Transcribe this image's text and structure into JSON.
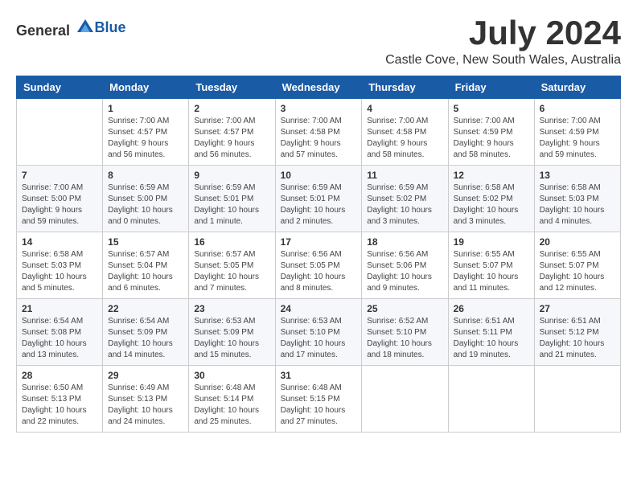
{
  "header": {
    "logo_general": "General",
    "logo_blue": "Blue",
    "month_year": "July 2024",
    "location": "Castle Cove, New South Wales, Australia"
  },
  "calendar": {
    "days_of_week": [
      "Sunday",
      "Monday",
      "Tuesday",
      "Wednesday",
      "Thursday",
      "Friday",
      "Saturday"
    ],
    "weeks": [
      [
        {
          "day": "",
          "info": ""
        },
        {
          "day": "1",
          "info": "Sunrise: 7:00 AM\nSunset: 4:57 PM\nDaylight: 9 hours\nand 56 minutes."
        },
        {
          "day": "2",
          "info": "Sunrise: 7:00 AM\nSunset: 4:57 PM\nDaylight: 9 hours\nand 56 minutes."
        },
        {
          "day": "3",
          "info": "Sunrise: 7:00 AM\nSunset: 4:58 PM\nDaylight: 9 hours\nand 57 minutes."
        },
        {
          "day": "4",
          "info": "Sunrise: 7:00 AM\nSunset: 4:58 PM\nDaylight: 9 hours\nand 58 minutes."
        },
        {
          "day": "5",
          "info": "Sunrise: 7:00 AM\nSunset: 4:59 PM\nDaylight: 9 hours\nand 58 minutes."
        },
        {
          "day": "6",
          "info": "Sunrise: 7:00 AM\nSunset: 4:59 PM\nDaylight: 9 hours\nand 59 minutes."
        }
      ],
      [
        {
          "day": "7",
          "info": "Sunrise: 7:00 AM\nSunset: 5:00 PM\nDaylight: 9 hours\nand 59 minutes."
        },
        {
          "day": "8",
          "info": "Sunrise: 6:59 AM\nSunset: 5:00 PM\nDaylight: 10 hours\nand 0 minutes."
        },
        {
          "day": "9",
          "info": "Sunrise: 6:59 AM\nSunset: 5:01 PM\nDaylight: 10 hours\nand 1 minute."
        },
        {
          "day": "10",
          "info": "Sunrise: 6:59 AM\nSunset: 5:01 PM\nDaylight: 10 hours\nand 2 minutes."
        },
        {
          "day": "11",
          "info": "Sunrise: 6:59 AM\nSunset: 5:02 PM\nDaylight: 10 hours\nand 3 minutes."
        },
        {
          "day": "12",
          "info": "Sunrise: 6:58 AM\nSunset: 5:02 PM\nDaylight: 10 hours\nand 3 minutes."
        },
        {
          "day": "13",
          "info": "Sunrise: 6:58 AM\nSunset: 5:03 PM\nDaylight: 10 hours\nand 4 minutes."
        }
      ],
      [
        {
          "day": "14",
          "info": "Sunrise: 6:58 AM\nSunset: 5:03 PM\nDaylight: 10 hours\nand 5 minutes."
        },
        {
          "day": "15",
          "info": "Sunrise: 6:57 AM\nSunset: 5:04 PM\nDaylight: 10 hours\nand 6 minutes."
        },
        {
          "day": "16",
          "info": "Sunrise: 6:57 AM\nSunset: 5:05 PM\nDaylight: 10 hours\nand 7 minutes."
        },
        {
          "day": "17",
          "info": "Sunrise: 6:56 AM\nSunset: 5:05 PM\nDaylight: 10 hours\nand 8 minutes."
        },
        {
          "day": "18",
          "info": "Sunrise: 6:56 AM\nSunset: 5:06 PM\nDaylight: 10 hours\nand 9 minutes."
        },
        {
          "day": "19",
          "info": "Sunrise: 6:55 AM\nSunset: 5:07 PM\nDaylight: 10 hours\nand 11 minutes."
        },
        {
          "day": "20",
          "info": "Sunrise: 6:55 AM\nSunset: 5:07 PM\nDaylight: 10 hours\nand 12 minutes."
        }
      ],
      [
        {
          "day": "21",
          "info": "Sunrise: 6:54 AM\nSunset: 5:08 PM\nDaylight: 10 hours\nand 13 minutes."
        },
        {
          "day": "22",
          "info": "Sunrise: 6:54 AM\nSunset: 5:09 PM\nDaylight: 10 hours\nand 14 minutes."
        },
        {
          "day": "23",
          "info": "Sunrise: 6:53 AM\nSunset: 5:09 PM\nDaylight: 10 hours\nand 15 minutes."
        },
        {
          "day": "24",
          "info": "Sunrise: 6:53 AM\nSunset: 5:10 PM\nDaylight: 10 hours\nand 17 minutes."
        },
        {
          "day": "25",
          "info": "Sunrise: 6:52 AM\nSunset: 5:10 PM\nDaylight: 10 hours\nand 18 minutes."
        },
        {
          "day": "26",
          "info": "Sunrise: 6:51 AM\nSunset: 5:11 PM\nDaylight: 10 hours\nand 19 minutes."
        },
        {
          "day": "27",
          "info": "Sunrise: 6:51 AM\nSunset: 5:12 PM\nDaylight: 10 hours\nand 21 minutes."
        }
      ],
      [
        {
          "day": "28",
          "info": "Sunrise: 6:50 AM\nSunset: 5:13 PM\nDaylight: 10 hours\nand 22 minutes."
        },
        {
          "day": "29",
          "info": "Sunrise: 6:49 AM\nSunset: 5:13 PM\nDaylight: 10 hours\nand 24 minutes."
        },
        {
          "day": "30",
          "info": "Sunrise: 6:48 AM\nSunset: 5:14 PM\nDaylight: 10 hours\nand 25 minutes."
        },
        {
          "day": "31",
          "info": "Sunrise: 6:48 AM\nSunset: 5:15 PM\nDaylight: 10 hours\nand 27 minutes."
        },
        {
          "day": "",
          "info": ""
        },
        {
          "day": "",
          "info": ""
        },
        {
          "day": "",
          "info": ""
        }
      ]
    ]
  }
}
